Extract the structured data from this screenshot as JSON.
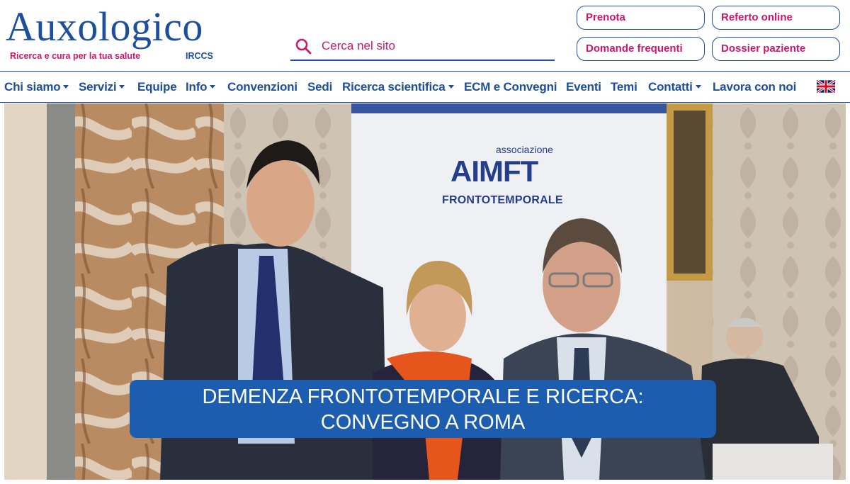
{
  "header": {
    "logo": {
      "name": "Auxologico",
      "tagline": "Ricerca e cura per la tua salute",
      "suffix": "IRCCS"
    },
    "search": {
      "placeholder": "Cerca nel sito",
      "icon": "search-icon"
    },
    "quick_links": {
      "prenota": "Prenota",
      "referto": "Referto online",
      "domande": "Domande frequenti",
      "dossier": "Dossier paziente"
    },
    "colors": {
      "brand_blue": "#1d4f9c",
      "brand_pink": "#d0156e"
    }
  },
  "nav": {
    "items": [
      {
        "label": "Chi siamo",
        "dropdown": true
      },
      {
        "label": "Servizi",
        "dropdown": true
      },
      {
        "label": "Equipe",
        "dropdown": false
      },
      {
        "label": "Info",
        "dropdown": true
      },
      {
        "label": "Convenzioni",
        "dropdown": false
      },
      {
        "label": "Sedi",
        "dropdown": false
      },
      {
        "label": "Ricerca scientifica",
        "dropdown": true
      },
      {
        "label": "ECM e Convegni",
        "dropdown": false
      },
      {
        "label": "Eventi",
        "dropdown": false
      },
      {
        "label": "Temi",
        "dropdown": false
      },
      {
        "label": "Contatti",
        "dropdown": true
      },
      {
        "label": "Lavora con noi",
        "dropdown": false
      }
    ],
    "language_icon": "uk-flag-icon"
  },
  "hero": {
    "banner": {
      "small": "associazione",
      "main": "AIMFT",
      "tagline": "FRONTOTEMPORALE"
    },
    "caption_line1": "DEMENZA FRONTOTEMPORALE E RICERCA:",
    "caption_line2": "CONVEGNO A ROMA",
    "caption_color": "#1d5db0"
  }
}
